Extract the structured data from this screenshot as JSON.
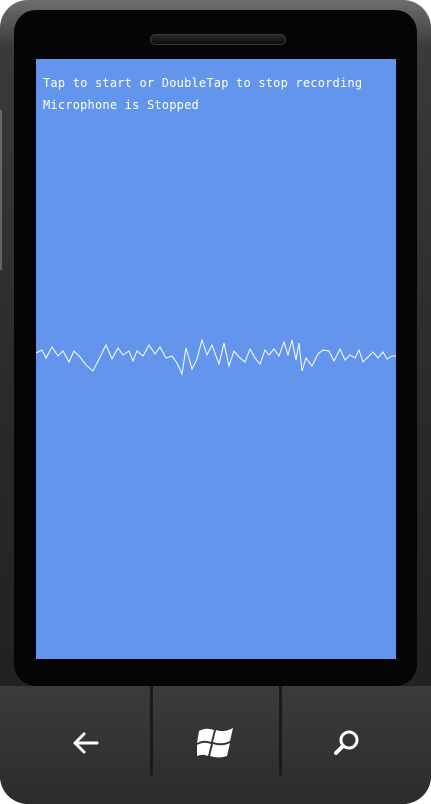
{
  "screen": {
    "background_color": "#6495ed",
    "instruction_text": "Tap to start or DoubleTap to stop recording",
    "status_text": "Microphone is Stopped",
    "waveform_color": "#ffffff"
  },
  "nav": {
    "back_icon": "back-arrow-icon",
    "start_icon": "windows-logo-icon",
    "search_icon": "search-icon"
  }
}
